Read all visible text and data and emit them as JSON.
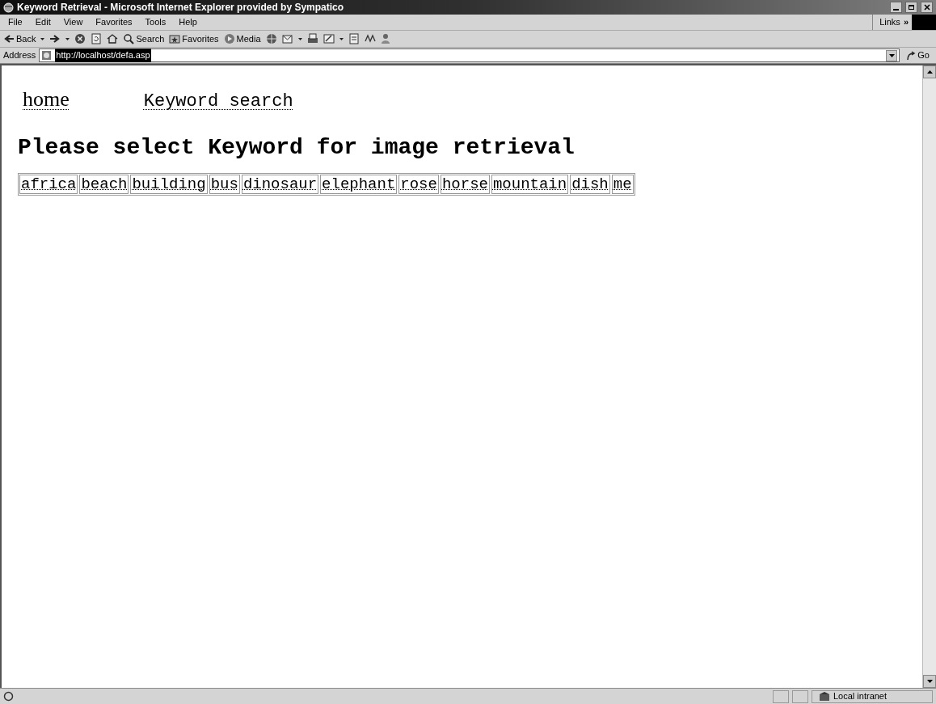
{
  "window": {
    "title": "Keyword Retrieval - Microsoft Internet Explorer provided by Sympatico"
  },
  "menu": [
    "File",
    "Edit",
    "View",
    "Favorites",
    "Tools",
    "Help"
  ],
  "links": {
    "label": "Links",
    "chevron": "»"
  },
  "toolbar": [
    {
      "kind": "labeled",
      "label": "Back"
    },
    {
      "kind": "icon"
    },
    {
      "kind": "icon"
    },
    {
      "kind": "icon"
    },
    {
      "kind": "icon"
    },
    {
      "kind": "labeled",
      "label": "Search"
    },
    {
      "kind": "labeled",
      "label": "Favorites"
    },
    {
      "kind": "labeled",
      "label": "Media"
    },
    {
      "kind": "icon"
    },
    {
      "kind": "icon"
    },
    {
      "kind": "icon"
    },
    {
      "kind": "icon"
    },
    {
      "kind": "icon"
    },
    {
      "kind": "icon"
    },
    {
      "kind": "icon"
    }
  ],
  "address": {
    "label": "Address",
    "url": "http://localhost/defa.asp",
    "go": "Go"
  },
  "page": {
    "nav": [
      "home",
      "Keyword search"
    ],
    "heading": "Please select Keyword for image retrieval",
    "keywords": [
      "africa",
      "beach",
      "building",
      "bus",
      "dinosaur",
      "elephant",
      "rose",
      "horse",
      "mountain",
      "dish",
      "me"
    ]
  },
  "status_bar": {
    "zone": "Local intranet"
  }
}
